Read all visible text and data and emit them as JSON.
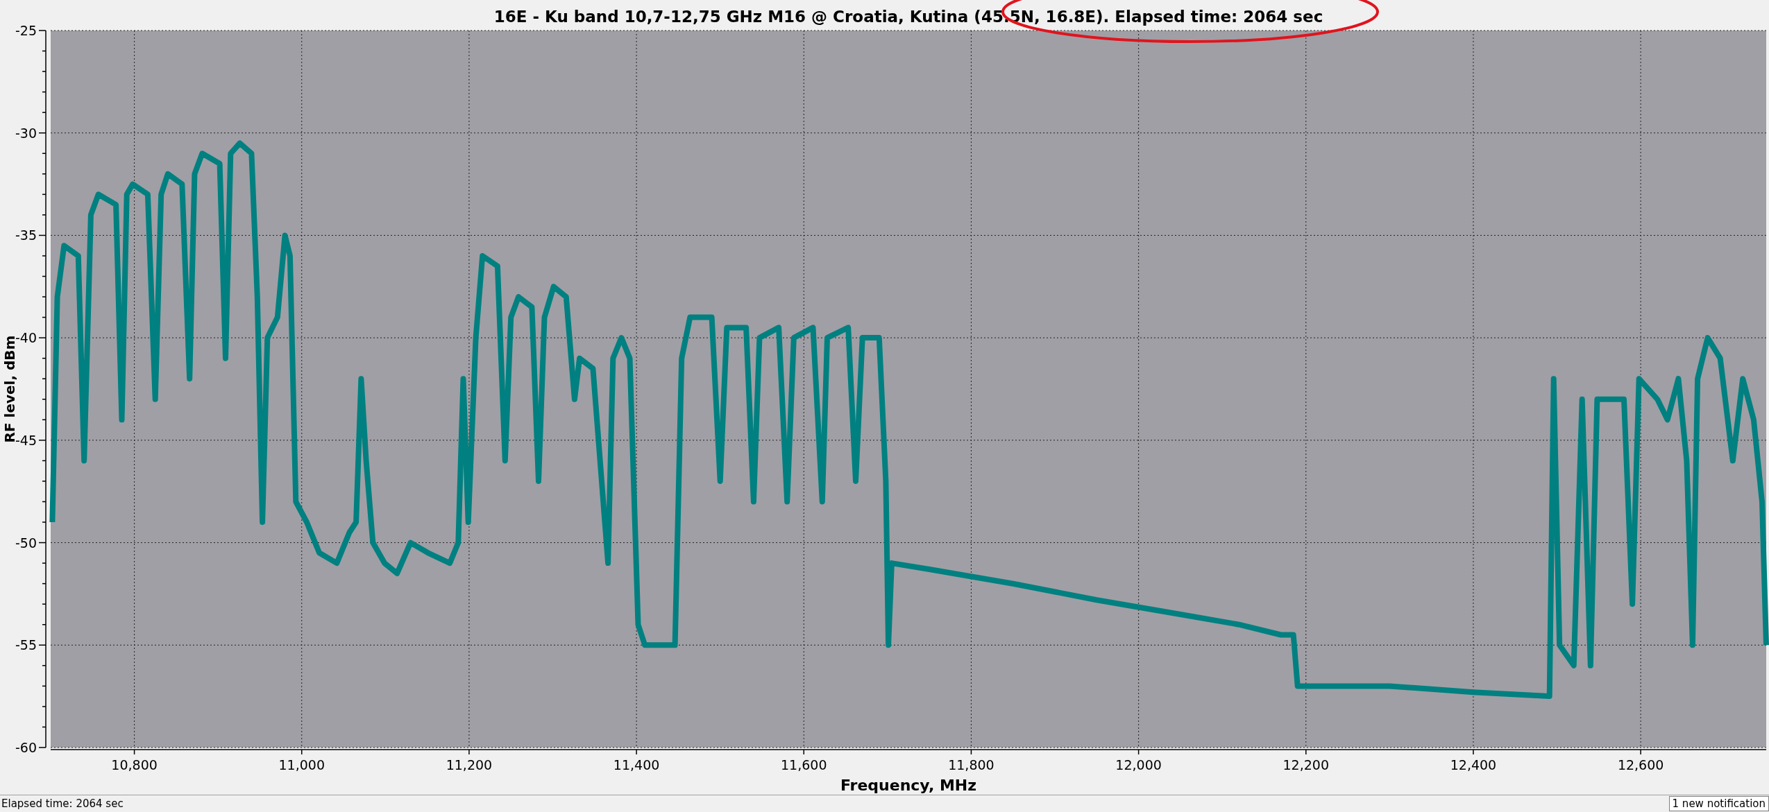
{
  "chart": {
    "chart_data": {
      "type": "line",
      "title": "16E - Ku band 10,7-12,75 GHz M16  @ Croatia, Kutina (45.5N, 16.8E). Elapsed time: 2064 sec",
      "xlabel": "Frequency, MHz",
      "ylabel": "RF level, dBm",
      "xlim": [
        10700,
        12750
      ],
      "ylim": [
        -60,
        -25
      ],
      "xticks": [
        {
          "value": 10800,
          "label": "10,800"
        },
        {
          "value": 11000,
          "label": "11,000"
        },
        {
          "value": 11200,
          "label": "11,200"
        },
        {
          "value": 11400,
          "label": "11,400"
        },
        {
          "value": 11600,
          "label": "11,600"
        },
        {
          "value": 11800,
          "label": "11,800"
        },
        {
          "value": 12000,
          "label": "12,000"
        },
        {
          "value": 12200,
          "label": "12,200"
        },
        {
          "value": 12400,
          "label": "12,400"
        },
        {
          "value": 12600,
          "label": "12,600"
        }
      ],
      "yticks": [
        -25,
        -30,
        -35,
        -40,
        -45,
        -50,
        -55,
        -60
      ],
      "x": [
        10702,
        10708,
        10716,
        10733,
        10740,
        10748,
        10757,
        10778,
        10785,
        10791,
        10798,
        10816,
        10825,
        10832,
        10840,
        10857,
        10866,
        10872,
        10881,
        10902,
        10909,
        10915,
        10926,
        10940,
        10947,
        10953,
        10959,
        10971,
        10980,
        10986,
        10993,
        11006,
        11021,
        11042,
        11057,
        11065,
        11071,
        11077,
        11085,
        11099,
        11114,
        11130,
        11151,
        11177,
        11187,
        11193,
        11199,
        11208,
        11216,
        11234,
        11243,
        11250,
        11259,
        11275,
        11283,
        11290,
        11301,
        11316,
        11326,
        11332,
        11348,
        11366,
        11372,
        11382,
        11392,
        11402,
        11410,
        11446,
        11454,
        11464,
        11490,
        11500,
        11508,
        11531,
        11540,
        11547,
        11570,
        11580,
        11588,
        11611,
        11622,
        11628,
        11653,
        11662,
        11670,
        11690,
        11698,
        11701,
        11705,
        11750,
        11850,
        11950,
        12050,
        12120,
        12170,
        12185,
        12190,
        12300,
        12400,
        12491,
        12496,
        12503,
        12520,
        12530,
        12540,
        12548,
        12580,
        12590,
        12598,
        12620,
        12632,
        12645,
        12655,
        12662,
        12668,
        12680,
        12695,
        12710,
        12722,
        12735,
        12745,
        12750
      ],
      "grid": true,
      "series": [
        {
          "color": "#008080",
          "values": [
            -49,
            -38,
            -35.5,
            -36,
            -46,
            -34,
            -33,
            -33.5,
            -44,
            -33,
            -32.5,
            -33,
            -43,
            -33,
            -32,
            -32.5,
            -42,
            -32,
            -31,
            -31.5,
            -41,
            -31,
            -30.5,
            -31,
            -38,
            -49,
            -40,
            -39,
            -35,
            -36,
            -48,
            -49,
            -50.5,
            -51,
            -49.5,
            -49,
            -42,
            -46,
            -50,
            -51,
            -51.5,
            -50,
            -50.5,
            -51,
            -50,
            -42,
            -49,
            -40,
            -36,
            -36.5,
            -46,
            -39,
            -38,
            -38.5,
            -47,
            -39,
            -37.5,
            -38,
            -43,
            -41,
            -41.5,
            -51,
            -41,
            -40,
            -41,
            -54,
            -55,
            -55,
            -41,
            -39,
            -39,
            -47,
            -39.5,
            -39.5,
            -48,
            -40,
            -39.5,
            -48,
            -40,
            -39.5,
            -48,
            -40,
            -39.5,
            -47,
            -40,
            -40,
            -47,
            -55,
            -51,
            -51.3,
            -52,
            -52.8,
            -53.5,
            -54,
            -54.5,
            -54.5,
            -57,
            -57,
            -57.3,
            -57.5,
            -42,
            -55,
            -56,
            -43,
            -56,
            -43,
            -43,
            -53,
            -42,
            -43,
            -44,
            -42,
            -46,
            -55,
            -42,
            -40,
            -41,
            -46,
            -42,
            -44,
            -48,
            -55
          ]
        }
      ]
    }
  },
  "status_bar": {
    "text": "Elapsed time: 2064 sec",
    "notification": "1 new notification"
  }
}
